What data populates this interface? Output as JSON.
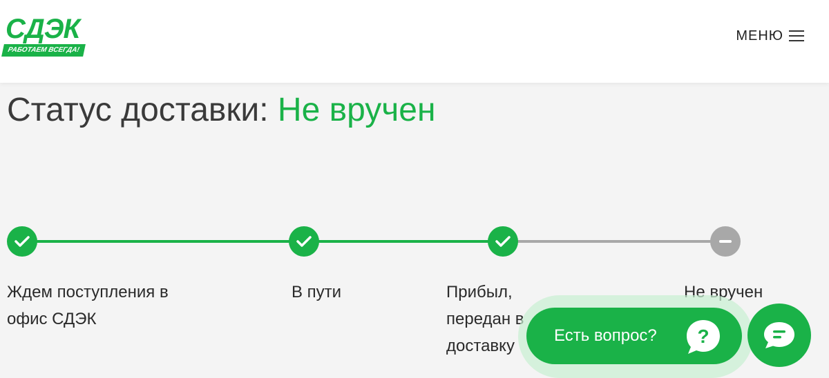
{
  "header": {
    "logo_text": "СДЭК",
    "logo_tagline": "РАБОТАЕМ ВСЕГДА!",
    "menu_label": "МЕНЮ"
  },
  "main": {
    "title_prefix": "Статус доставки:",
    "title_status": "Не вручен"
  },
  "steps": [
    {
      "label_line1": "Ждем поступления в",
      "label_line2": "офис СДЭК",
      "state": "done"
    },
    {
      "label_line1": "В пути",
      "label_line2": "",
      "state": "done"
    },
    {
      "label_line1": "Прибыл,",
      "label_line2": "передан в",
      "label_line3": "доставку",
      "state": "done"
    },
    {
      "label_line1": "Не вручен",
      "label_line2": "",
      "state": "failed"
    }
  ],
  "help": {
    "ask_label": "Есть вопрос?"
  },
  "colors": {
    "brand_green": "#1ab248",
    "inactive_gray": "#a8a8a8"
  }
}
